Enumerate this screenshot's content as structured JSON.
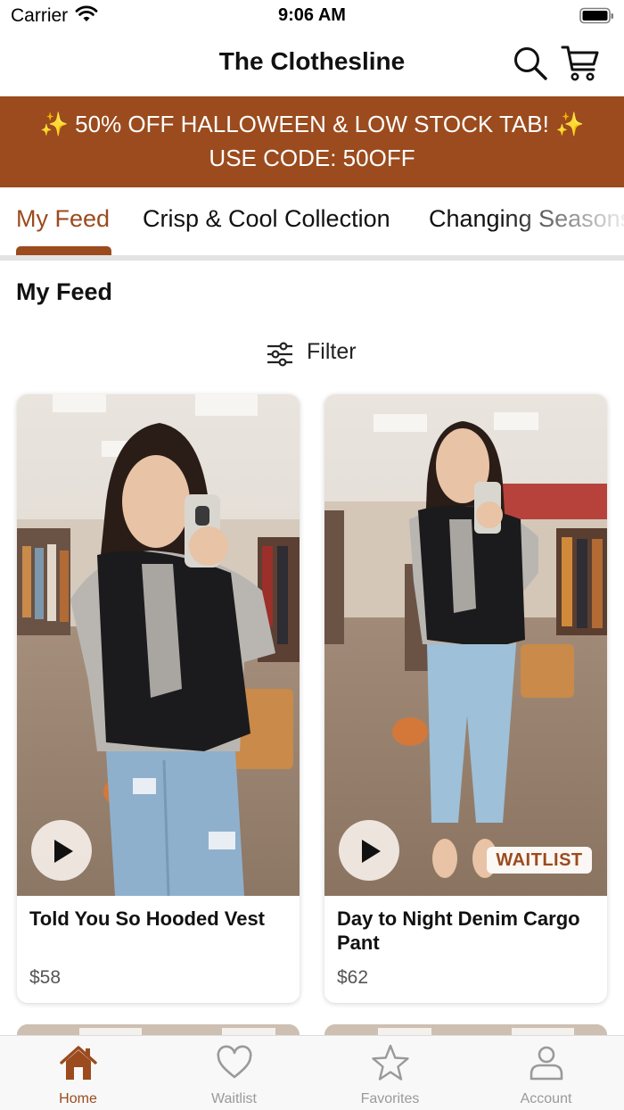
{
  "status_bar": {
    "carrier": "Carrier",
    "time": "9:06 AM"
  },
  "header": {
    "title": "The Clothesline",
    "search_icon": "search-icon",
    "cart_icon": "cart-icon"
  },
  "promo": {
    "line1": "✨ 50% OFF HALLOWEEN & LOW STOCK TAB! ✨",
    "line2": "USE CODE: 50OFF"
  },
  "tabs": [
    {
      "label": "My Feed",
      "active": true
    },
    {
      "label": "Crisp & Cool Collection",
      "active": false
    },
    {
      "label": "Changing Seasons",
      "active": false
    }
  ],
  "feed": {
    "title": "My Feed",
    "filter_label": "Filter",
    "products": [
      {
        "name": "Told You So Hooded Vest",
        "price": "$58",
        "play_icon": "play-icon"
      },
      {
        "name": "Day to Night Denim Cargo Pant",
        "price": "$62",
        "play_icon": "play-icon",
        "badge": "WAITLIST"
      }
    ]
  },
  "tabbar": {
    "items": [
      {
        "label": "Home",
        "icon": "home-icon",
        "active": true
      },
      {
        "label": "Waitlist",
        "icon": "heart-icon",
        "active": false
      },
      {
        "label": "Favorites",
        "icon": "star-icon",
        "active": false
      },
      {
        "label": "Account",
        "icon": "person-icon",
        "active": false
      }
    ]
  },
  "colors": {
    "brand": "#9b4b1e",
    "inactive": "#9a9a9a",
    "tab_divider": "#e3e3e3"
  }
}
